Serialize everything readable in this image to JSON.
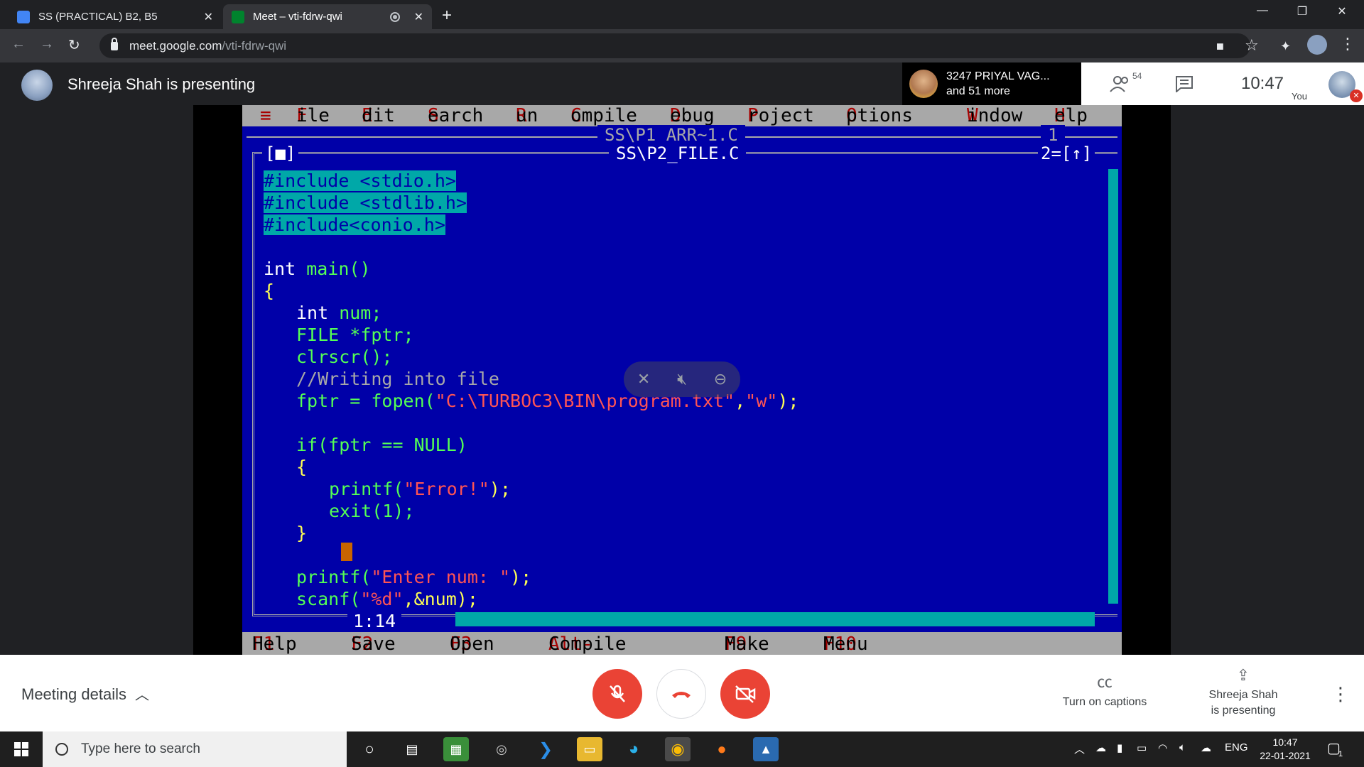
{
  "browser": {
    "tabs": [
      {
        "title": "SS (PRACTICAL) B2, B5",
        "favicon_color": "#4285f4"
      },
      {
        "title": "Meet – vti-fdrw-qwi",
        "favicon_color": "#00832d"
      }
    ],
    "url_host": "meet.google.com",
    "url_path": "/vti-fdrw-qwi",
    "new_tab": "+",
    "window_controls": {
      "minimize": "—",
      "restore": "❐",
      "close": "✕"
    }
  },
  "meet": {
    "presenting_banner": "Shreeja Shah is presenting",
    "pinned": {
      "line1": "3247 PRIYAL VAG...",
      "line2": "and 51 more"
    },
    "participants_count": "54",
    "time": "10:47",
    "you_label": "You",
    "meeting_details": "Meeting details",
    "captions_label": "Turn on captions",
    "presenting_line1": "Shreeja Shah",
    "presenting_line2": "is presenting"
  },
  "ide": {
    "menu": [
      {
        "hot": "≡",
        "rest": ""
      },
      {
        "hot": "F",
        "rest": "ile"
      },
      {
        "hot": "E",
        "rest": "dit"
      },
      {
        "hot": "S",
        "rest": "earch"
      },
      {
        "hot": "R",
        "rest": "un"
      },
      {
        "hot": "C",
        "rest": "ompile"
      },
      {
        "hot": "D",
        "rest": "ebug"
      },
      {
        "hot": "P",
        "rest": "roject"
      },
      {
        "hot": "O",
        "rest": "ptions"
      },
      {
        "hot": "W",
        "rest": "indow"
      },
      {
        "hot": "H",
        "rest": "elp"
      }
    ],
    "back_window_title": "SS\\P1_ARR~1.C",
    "back_window_number": "1",
    "front_window_title": "SS\\P2_FILE.C",
    "front_window_close": "[■]",
    "front_window_number": "2=[↑]",
    "position": "1:14",
    "code": {
      "inc1": "#include <stdio.h>",
      "inc2": "#include <stdlib.h>",
      "inc3": "#include<conio.h>",
      "main_kw": "int",
      "main_fn": " main()",
      "brace_open": "{",
      "decl_int_kw": "int",
      "decl_int_rest": " num;",
      "decl_file_kw": "FILE",
      "decl_file_rest": " *fptr;",
      "clrscr": "clrscr();",
      "comment": "//Writing into file",
      "fopen_a": "fptr = fopen(",
      "fopen_str1": "\"C:\\TURBOC3\\BIN\\program.txt\"",
      "fopen_b": ",",
      "fopen_str2": "\"w\"",
      "fopen_c": ");",
      "if_line": "if(fptr == NULL)",
      "if_open": "{",
      "printf_a": "printf(",
      "printf_str": "\"Error!\"",
      "printf_b": ");",
      "exit_line": "exit(1);",
      "if_close": "}",
      "printf2_a": "printf(",
      "printf2_str": "\"Enter num: \"",
      "printf2_b": ");",
      "scanf_a": "scanf(",
      "scanf_str": "\"%d\"",
      "scanf_b": ",&num);"
    },
    "status": [
      {
        "key": "F1",
        "label": " Help"
      },
      {
        "key": "F2",
        "label": " Save"
      },
      {
        "key": "F3",
        "label": " Open"
      },
      {
        "key": "Alt-F9",
        "label": " Compile"
      },
      {
        "key": "F9",
        "label": " Make"
      },
      {
        "key": "F10",
        "label": " Menu"
      }
    ]
  },
  "taskbar": {
    "search_placeholder": "Type here to search",
    "language": "ENG",
    "time": "10:47",
    "date": "22-01-2021",
    "notification_count": "1"
  },
  "colors": {
    "ide_blue": "#0000a8",
    "ide_gray": "#a8a8a8",
    "meet_red": "#ea4335"
  }
}
